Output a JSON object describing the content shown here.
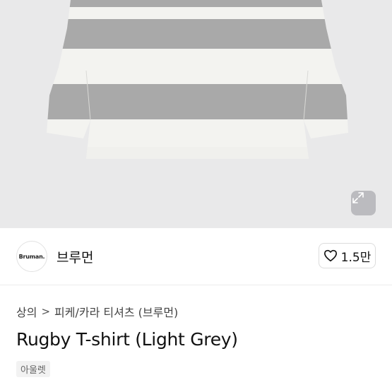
{
  "brand": {
    "logo_text": "Bruman.",
    "name": "브루먼"
  },
  "like": {
    "count": "1.5만"
  },
  "breadcrumb": {
    "category": "상의",
    "separator": ">",
    "subcategory": "피케/카라 티셔츠 (브루먼)"
  },
  "product": {
    "title": "Rugby T-shirt (Light Grey)",
    "badge": "아울렛"
  },
  "colors": {
    "image_background": "#e9e9ea",
    "stripe_grey": "#a9a9a9",
    "stripe_white": "#f3f3f0"
  },
  "icons": {
    "expand": "expand-arrows-icon",
    "like": "heart-outline-icon"
  }
}
